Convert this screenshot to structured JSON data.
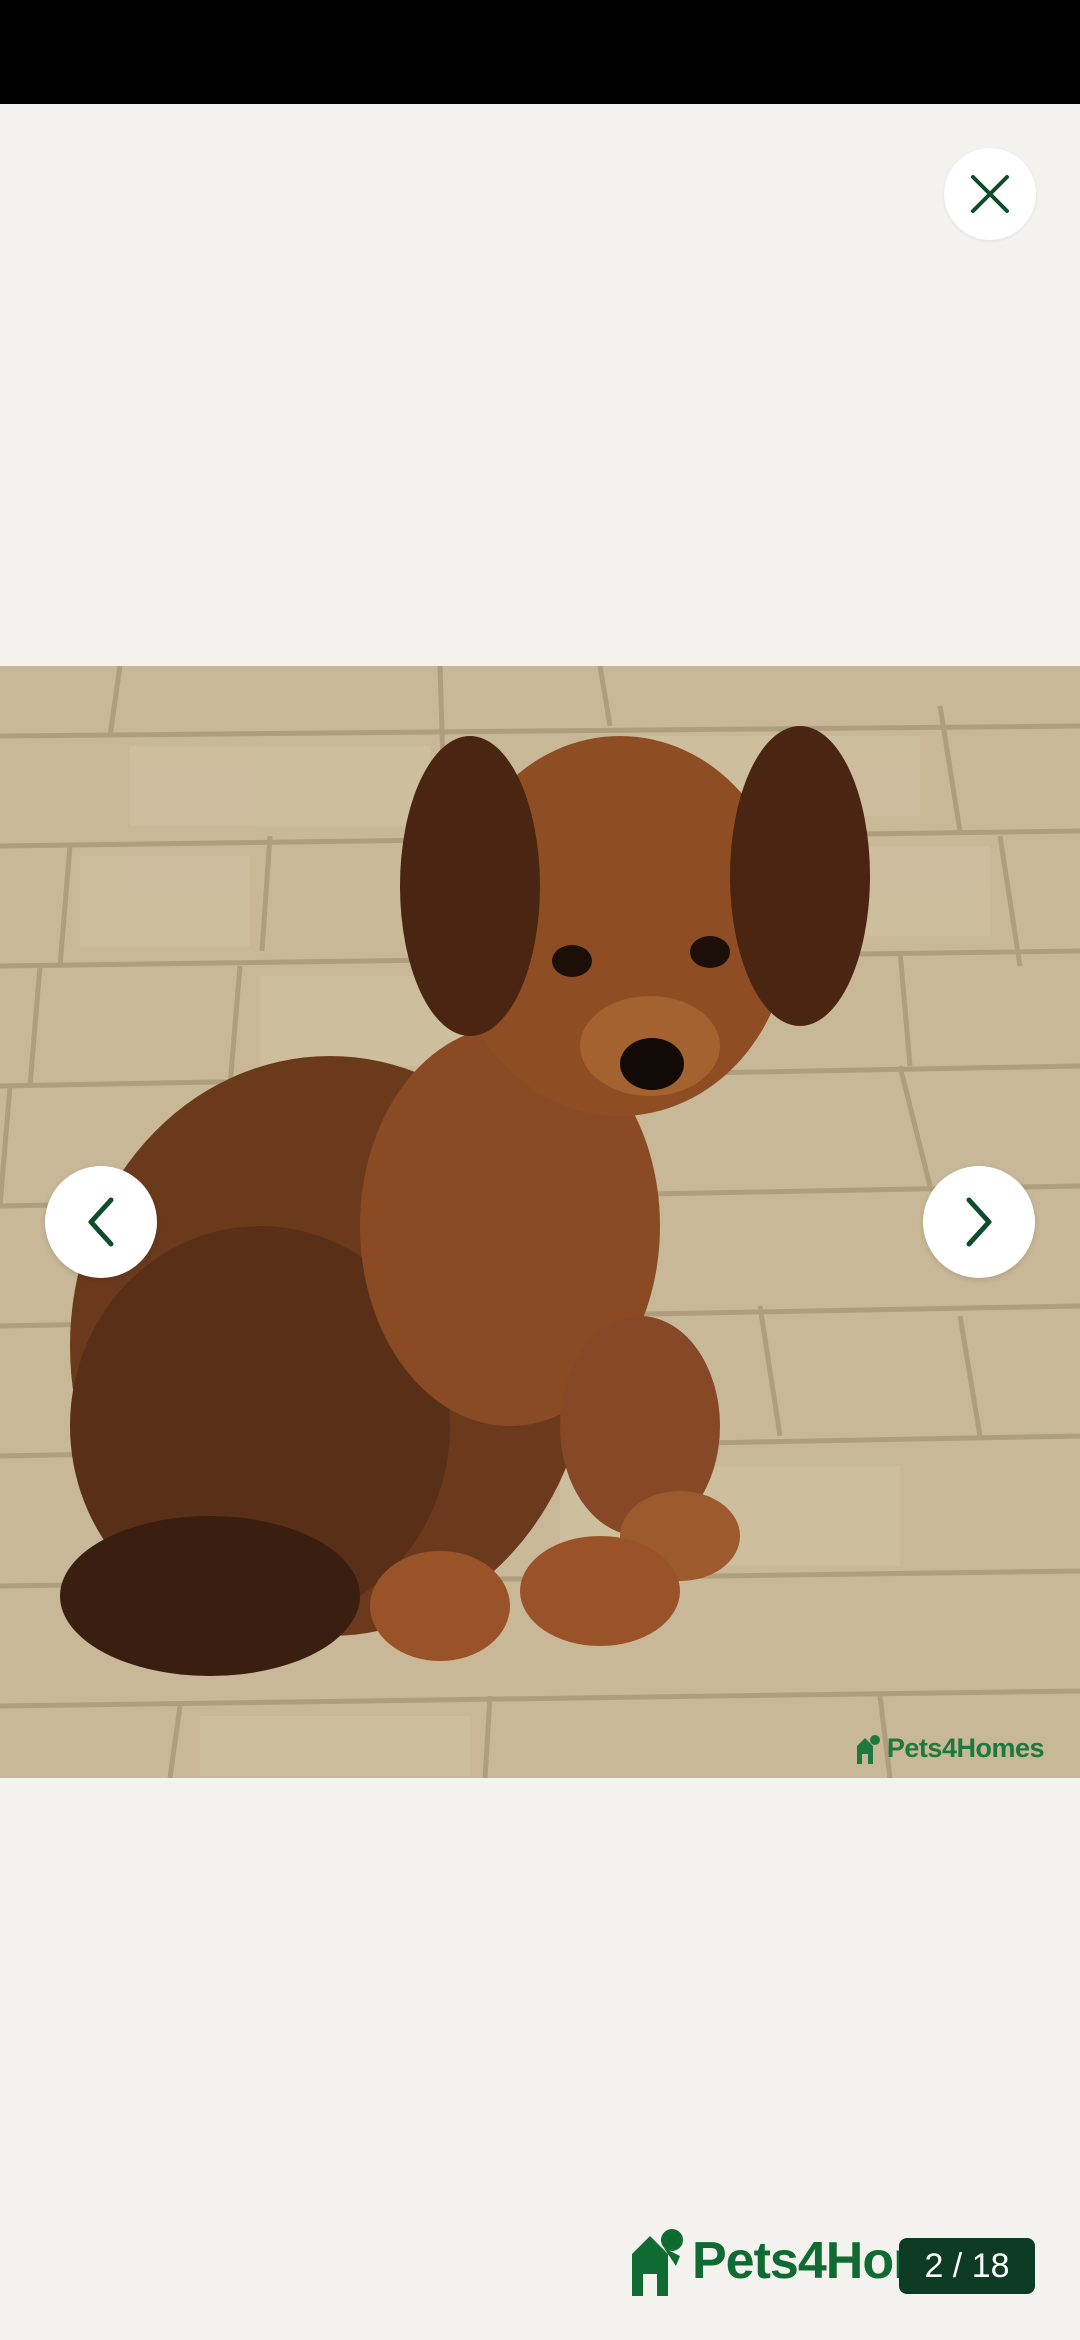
{
  "photo_watermark": "Pets4Homes",
  "brand": {
    "name": "Pets4Homes"
  },
  "gallery": {
    "counter": "2 / 18"
  },
  "icons": {
    "close": "close-icon",
    "prev": "chevron-left-icon",
    "next": "chevron-right-icon",
    "logo": "house-dog-logo-icon"
  },
  "colors": {
    "brand_green": "#0f6b32",
    "counter_bg": "#0d3b23",
    "background": "#f3f2ef"
  }
}
